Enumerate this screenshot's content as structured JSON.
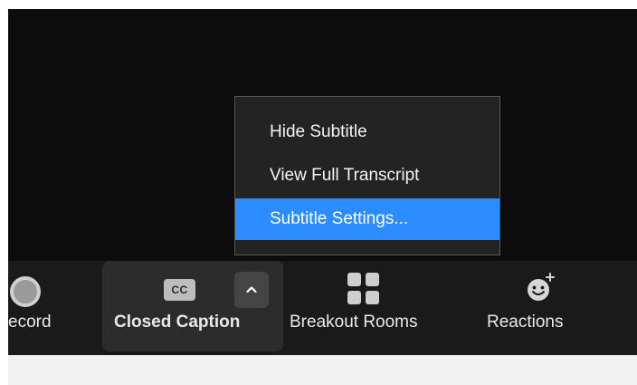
{
  "menu": {
    "items": [
      {
        "label": "Hide Subtitle",
        "active": false
      },
      {
        "label": "View Full Transcript",
        "active": false
      },
      {
        "label": "Subtitle Settings...",
        "active": true
      }
    ]
  },
  "toolbar": {
    "record": {
      "label": "ecord",
      "icon": "record-icon"
    },
    "closed_caption": {
      "label": "Closed Caption",
      "icon_text": "CC",
      "icon": "cc-icon",
      "caret_icon": "chevron-up-icon"
    },
    "breakout": {
      "label": "Breakout Rooms",
      "icon": "grid-icon"
    },
    "reactions": {
      "label": "Reactions",
      "icon": "smile-plus-icon"
    }
  },
  "colors": {
    "accent": "#2d8cff",
    "toolbar_bg": "#1a1a1a",
    "menu_bg": "#232323"
  }
}
